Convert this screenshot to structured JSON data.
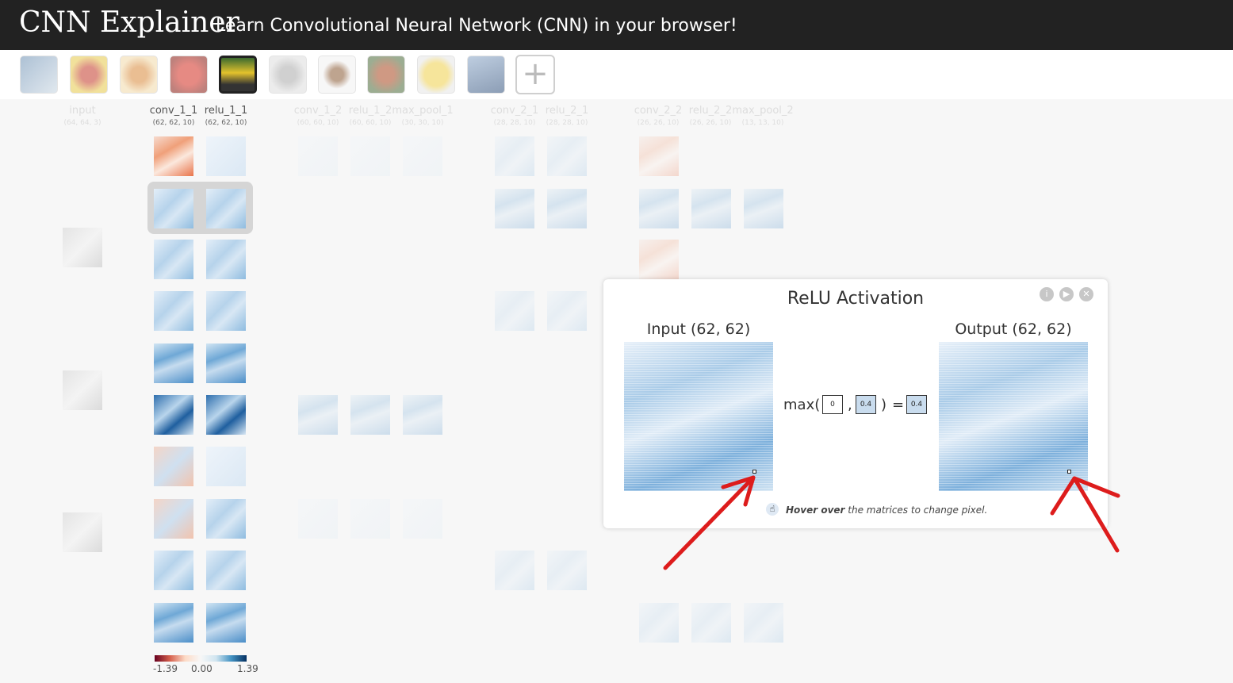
{
  "header": {
    "brand": "CNN Explainer",
    "subtitle": "Learn Convolutional Neural Network (CNN) in your browser!"
  },
  "thumbnails": [
    {
      "name": "boat"
    },
    {
      "name": "ladybug"
    },
    {
      "name": "pizza"
    },
    {
      "name": "bell pepper"
    },
    {
      "name": "school bus",
      "selected": true
    },
    {
      "name": "koala"
    },
    {
      "name": "espresso"
    },
    {
      "name": "red panda"
    },
    {
      "name": "orange"
    },
    {
      "name": "sport car"
    }
  ],
  "add_icon": "+",
  "layers": [
    {
      "name": "input",
      "dim": "(64, 64, 3)"
    },
    {
      "name": "conv_1_1",
      "dim": "(62, 62, 10)"
    },
    {
      "name": "relu_1_1",
      "dim": "(62, 62, 10)"
    },
    {
      "name": "conv_1_2",
      "dim": "(60, 60, 10)"
    },
    {
      "name": "relu_1_2",
      "dim": "(60, 60, 10)"
    },
    {
      "name": "max_pool_1",
      "dim": "(30, 30, 10)"
    },
    {
      "name": "conv_2_1",
      "dim": "(28, 28, 10)"
    },
    {
      "name": "relu_2_1",
      "dim": "(28, 28, 10)"
    },
    {
      "name": "conv_2_2",
      "dim": "(26, 26, 10)"
    },
    {
      "name": "relu_2_2",
      "dim": "(26, 26, 10)"
    },
    {
      "name": "max_pool_2",
      "dim": "(13, 13, 10)"
    }
  ],
  "legend": {
    "min": "-1.39",
    "mid": "0.00",
    "max": "1.39"
  },
  "modal": {
    "title": "ReLU Activation",
    "input_label": "Input (62, 62)",
    "output_label": "Output (62, 62)",
    "formula_prefix": "max(",
    "comma": ",",
    "formula_suffix": ")",
    "equals": "=",
    "zero": "0",
    "input_value": "0.4",
    "output_value": "0.4",
    "hint_bold": "Hover over",
    "hint_rest": "the matrices to change pixel.",
    "info_icon": "i",
    "play_icon": "▶",
    "close_icon": "✕"
  },
  "colors": {
    "header_bg": "#222222",
    "annotation": "#dd1c1c"
  }
}
